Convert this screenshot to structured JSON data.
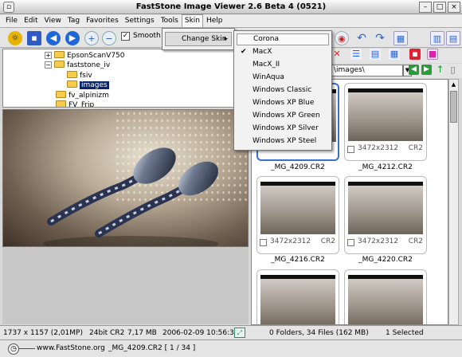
{
  "window": {
    "title": "FastStone Image Viewer  2.6 Beta 4 (0521)"
  },
  "menu": [
    "File",
    "Edit",
    "View",
    "Tag",
    "Favorites",
    "Settings",
    "Tools",
    "Skin",
    "Help"
  ],
  "toolbar": {
    "smooth_label": "Smooth"
  },
  "tree": [
    {
      "label": "EpsonScanV750"
    },
    {
      "label": "faststone_iv"
    },
    {
      "label": "fsiv"
    },
    {
      "label": "images"
    },
    {
      "label": "fv_alpinizm"
    },
    {
      "label": "FV_Frip"
    }
  ],
  "skin_menu": {
    "item": "Change Skin",
    "arrow": "▸"
  },
  "skins": {
    "options": [
      "Corona",
      "MacX",
      "MacX_II",
      "WinAqua",
      "Windows Classic",
      "Windows XP Blue",
      "Windows XP Green",
      "Windows XP Silver",
      "Windows XP Steel"
    ],
    "checked": "MacX",
    "highlighted": "Corona",
    "check_glyph": "✔"
  },
  "path": {
    "value": "\\images\\"
  },
  "thumbnails": [
    {
      "name": "_MG_4209.CR2",
      "dims": "",
      "type": ""
    },
    {
      "name": "_MG_4212.CR2",
      "dims": "3472x2312",
      "type": "CR2"
    },
    {
      "name": "_MG_4216.CR2",
      "dims": "3472x2312",
      "type": "CR2"
    },
    {
      "name": "_MG_4220.CR2",
      "dims": "3472x2312",
      "type": "CR2"
    },
    {
      "name": "",
      "dims": "",
      "type": ""
    },
    {
      "name": "",
      "dims": "",
      "type": ""
    }
  ],
  "status": {
    "dimensions": "1737 x 1157 (2,01MP)",
    "bitdepth": "24bit CR2",
    "filesize": "7,17 MB",
    "datetime": "2006-02-09 10:56:36",
    "folders": "0 Folders, 34 Files (162 MB)",
    "selected": "1 Selected",
    "website": "www.FastStone.org",
    "current_file": "_MG_4209.CR2 [ 1 / 34 ]"
  }
}
